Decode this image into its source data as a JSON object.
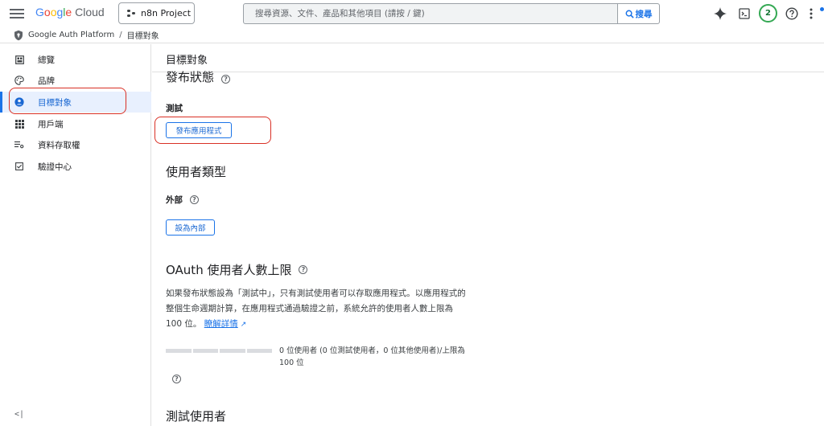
{
  "header": {
    "logo": {
      "g": "G",
      "o1": "o",
      "o2": "o",
      "g2": "g",
      "l": "l",
      "e": "e",
      "cloud": "Cloud"
    },
    "project": "n8n Project",
    "search_placeholder": "搜尋資源、文件、產品和其他項目 (請按 / 鍵)",
    "search_button": "搜尋",
    "avatar_letter": "2",
    "icons": [
      "menu-icon",
      "gemini-icon",
      "cloud-shell-icon",
      "help-icon",
      "more-vert-icon"
    ]
  },
  "breadcrumb": {
    "product": "Google Auth Platform",
    "separator": "/",
    "page": "目標對象"
  },
  "sidebar": {
    "items": [
      {
        "label": "總覽",
        "icon": "dashboard-icon"
      },
      {
        "label": "品牌",
        "icon": "palette-icon"
      },
      {
        "label": "目標對象",
        "icon": "person-icon",
        "active": true
      },
      {
        "label": "用戶端",
        "icon": "grid-icon"
      },
      {
        "label": "資料存取權",
        "icon": "data-access-icon"
      },
      {
        "label": "驗證中心",
        "icon": "checkbox-icon"
      }
    ],
    "collapse": "<|"
  },
  "main": {
    "title": "目標對象",
    "publish": {
      "heading": "發布狀態",
      "status": "測試",
      "button": "發布應用程式"
    },
    "user_type": {
      "heading": "使用者類型",
      "type": "外部",
      "button": "設為內部"
    },
    "oauth": {
      "heading": "OAuth 使用者人數上限",
      "description": "如果發布狀態設為「測試中」，只有測試使用者可以存取應用程式。以應用程式的整個生命週期計算，在應用程式通過驗證之前，系統允許的使用者人數上限為 100 位。",
      "link": "瞭解詳情",
      "progress_text": "0 位使用者 (0 位測試使用者，0 位其他使用者)/上限為 100 位",
      "progress_value": 0
    },
    "test_users": {
      "heading": "測試使用者"
    }
  },
  "colors": {
    "accent": "#1a73e8",
    "annotation": "#d93025",
    "active_bg": "#e8f0fe"
  }
}
